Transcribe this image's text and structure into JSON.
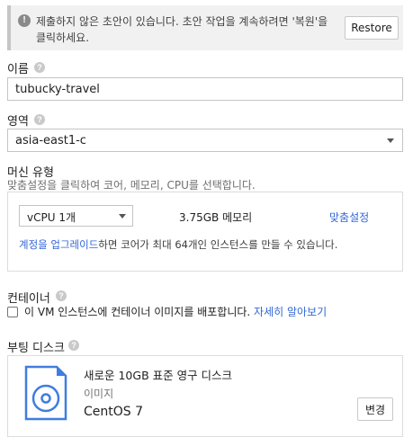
{
  "banner": {
    "message": "제출하지 않은 초안이 있습니다. 초안 작업을 계속하려면 '복원'을 클릭하세요.",
    "restore_label": "Restore"
  },
  "name": {
    "label": "이름",
    "value": "tubucky-travel"
  },
  "zone": {
    "label": "영역",
    "value": "asia-east1-c"
  },
  "machine_type": {
    "label": "머신 유형",
    "description": "맞춤설정을 클릭하여 코어, 메모리, CPU를 선택합니다.",
    "vcpu_value": "vCPU 1개",
    "memory": "3.75GB 메모리",
    "customize_label": "맞춤설정",
    "upgrade_link": "계정을 업그레이드",
    "upgrade_text": "하면 코어가 최대 64개인 인스턴스를 만들 수 있습니다."
  },
  "container": {
    "label": "컨테이너",
    "checkbox_text": "이 VM 인스턴스에 컨테이너 이미지를 배포합니다.",
    "learn_more": "자세히 알아보기",
    "checked": false
  },
  "boot_disk": {
    "label": "부팅 디스크",
    "title": "새로운 10GB 표준 영구 디스크",
    "image_label": "이미지",
    "image": "CentOS 7",
    "change_label": "변경"
  },
  "colors": {
    "link": "#3367d6",
    "disk_icon": "#3f7de0"
  },
  "icons": {
    "info": "info-icon",
    "help": "help-icon",
    "dropdown": "caret-down-icon",
    "disk": "disk-image-icon"
  }
}
